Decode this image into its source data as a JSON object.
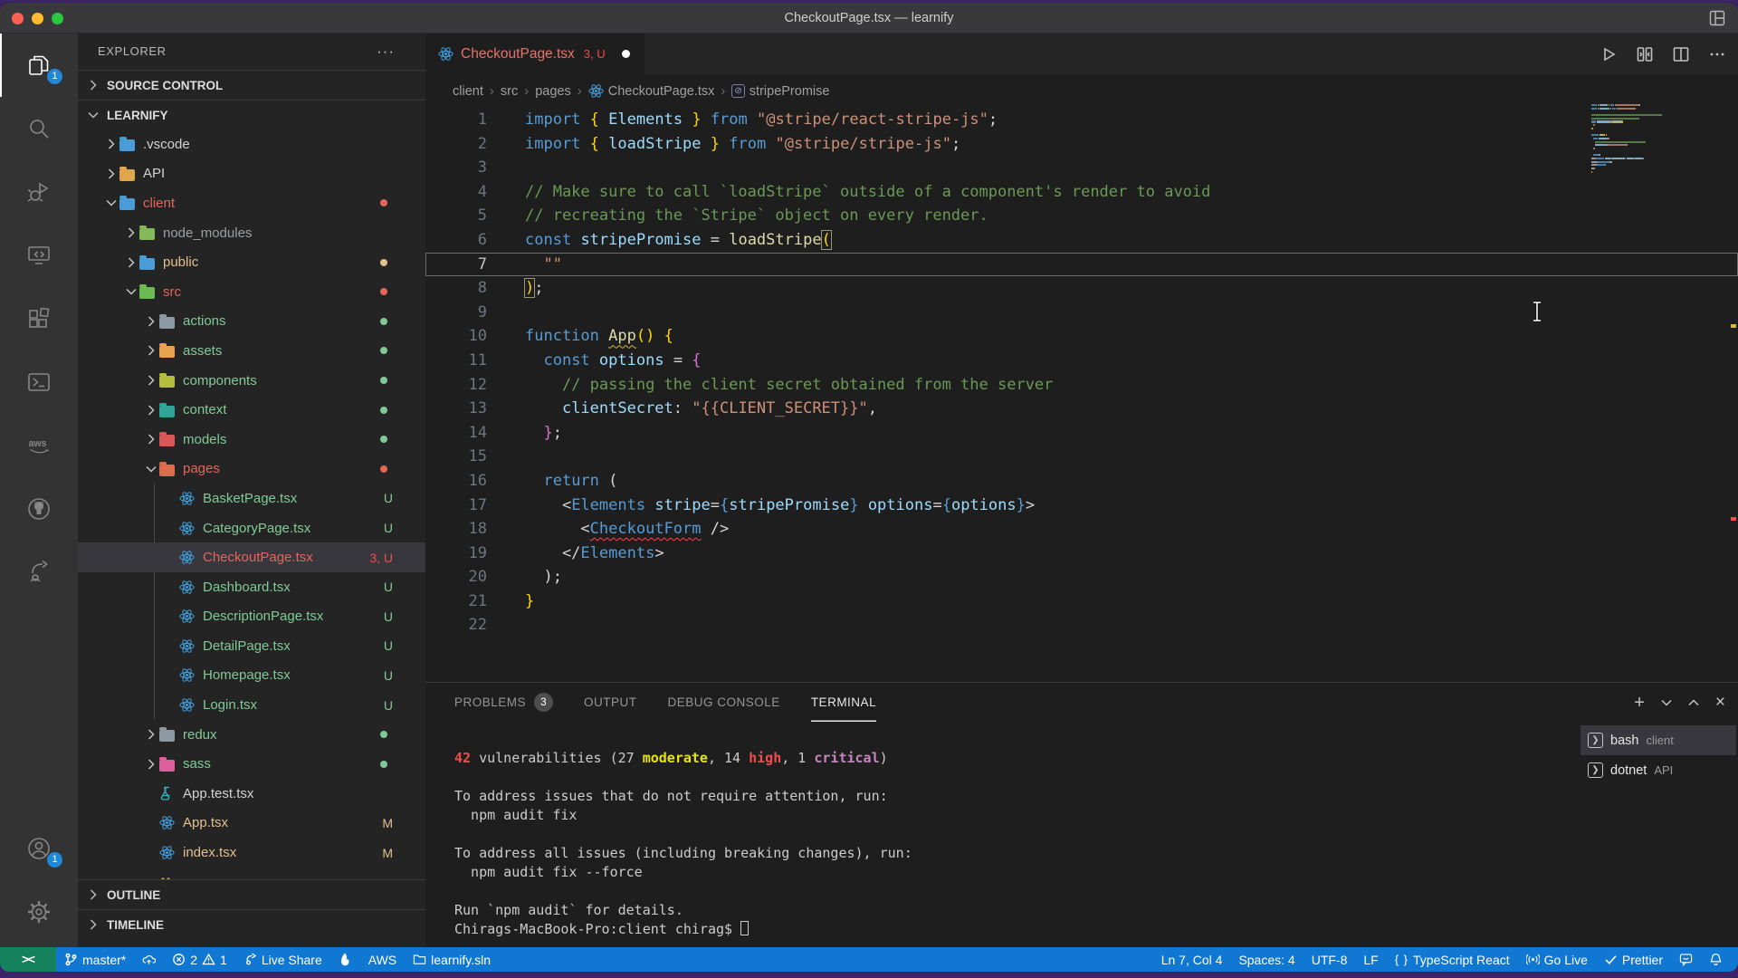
{
  "window": {
    "title": "CheckoutPage.tsx — learnify",
    "traffic_lights": [
      "close",
      "minimize",
      "zoom"
    ],
    "titlebar_right_icon": "layout-grid-icon"
  },
  "activity_bar": {
    "items": [
      {
        "name": "explorer",
        "icon": "files-icon",
        "badge": "1",
        "active": true
      },
      {
        "name": "search",
        "icon": "search-icon"
      },
      {
        "name": "run-debug",
        "icon": "debug-icon"
      },
      {
        "name": "remote-explorer",
        "icon": "remote-icon"
      },
      {
        "name": "extensions",
        "icon": "extensions-icon"
      },
      {
        "name": "powershell",
        "icon": "powershell-icon"
      },
      {
        "name": "aws",
        "icon": "aws-icon"
      },
      {
        "name": "github",
        "icon": "github-icon"
      },
      {
        "name": "live-share",
        "icon": "liveshare-icon"
      }
    ],
    "bottom_items": [
      {
        "name": "accounts",
        "icon": "account-icon",
        "badge": "1"
      },
      {
        "name": "settings",
        "icon": "gear-icon"
      }
    ]
  },
  "sidebar": {
    "header": "EXPLORER",
    "more_icon": "ellipsis-icon",
    "source_control_label": "SOURCE CONTROL",
    "workspace_label": "LEARNIFY",
    "outline_label": "OUTLINE",
    "timeline_label": "TIMELINE",
    "tree": [
      {
        "label": ".vscode",
        "kind": "folder",
        "level": 1,
        "chev": "right",
        "fcolor": "#4a9cd6",
        "tcolor": "def"
      },
      {
        "label": "API",
        "kind": "folder",
        "level": 1,
        "chev": "right",
        "fcolor": "#e0a64e",
        "tcolor": "def"
      },
      {
        "label": "client",
        "kind": "folder",
        "level": 1,
        "chev": "down",
        "fcolor": "#4a9cd6",
        "tcolor": "red",
        "dot": "#e5655b"
      },
      {
        "label": "node_modules",
        "kind": "folder",
        "level": 2,
        "chev": "right",
        "fcolor": "#85b857",
        "tcolor": "gray"
      },
      {
        "label": "public",
        "kind": "folder",
        "level": 2,
        "chev": "right",
        "fcolor": "#4a9cd6",
        "tcolor": "yellow",
        "dot": "#e2c08d"
      },
      {
        "label": "src",
        "kind": "folder",
        "level": 2,
        "chev": "down",
        "fcolor": "#6cba53",
        "tcolor": "red",
        "dot": "#e5655b"
      },
      {
        "label": "actions",
        "kind": "folder",
        "level": 3,
        "chev": "right",
        "fcolor": "#8e9aa3",
        "tcolor": "green",
        "dot": "#81c995"
      },
      {
        "label": "assets",
        "kind": "folder",
        "level": 3,
        "chev": "right",
        "fcolor": "#e8a14e",
        "tcolor": "green",
        "dot": "#81c995"
      },
      {
        "label": "components",
        "kind": "folder",
        "level": 3,
        "chev": "right",
        "fcolor": "#b5bd3e",
        "tcolor": "green",
        "dot": "#81c995"
      },
      {
        "label": "context",
        "kind": "folder",
        "level": 3,
        "chev": "right",
        "fcolor": "#2fa59a",
        "tcolor": "green",
        "dot": "#81c995"
      },
      {
        "label": "models",
        "kind": "folder",
        "level": 3,
        "chev": "right",
        "fcolor": "#d95757",
        "tcolor": "green",
        "dot": "#81c995"
      },
      {
        "label": "pages",
        "kind": "folder",
        "level": 3,
        "chev": "down",
        "fcolor": "#dd6b4d",
        "tcolor": "red",
        "dot": "#e5655b"
      },
      {
        "label": "BasketPage.tsx",
        "kind": "react",
        "level": 4,
        "tcolor": "green",
        "badge": "U",
        "bcolor": "green"
      },
      {
        "label": "CategoryPage.tsx",
        "kind": "react",
        "level": 4,
        "tcolor": "green",
        "badge": "U",
        "bcolor": "green"
      },
      {
        "label": "CheckoutPage.tsx",
        "kind": "react",
        "level": 4,
        "tcolor": "red",
        "badge": "3, U",
        "bcolor": "red",
        "selected": true
      },
      {
        "label": "Dashboard.tsx",
        "kind": "react",
        "level": 4,
        "tcolor": "green",
        "badge": "U",
        "bcolor": "green"
      },
      {
        "label": "DescriptionPage.tsx",
        "kind": "react",
        "level": 4,
        "tcolor": "green",
        "badge": "U",
        "bcolor": "green"
      },
      {
        "label": "DetailPage.tsx",
        "kind": "react",
        "level": 4,
        "tcolor": "green",
        "badge": "U",
        "bcolor": "green"
      },
      {
        "label": "Homepage.tsx",
        "kind": "react",
        "level": 4,
        "tcolor": "green",
        "badge": "U",
        "bcolor": "green"
      },
      {
        "label": "Login.tsx",
        "kind": "react",
        "level": 4,
        "tcolor": "green",
        "badge": "U",
        "bcolor": "green"
      },
      {
        "label": "redux",
        "kind": "folder",
        "level": 3,
        "chev": "right",
        "fcolor": "#8e9aa3",
        "tcolor": "green",
        "dot": "#81c995"
      },
      {
        "label": "sass",
        "kind": "folder",
        "level": 3,
        "chev": "right",
        "fcolor": "#dd5f9e",
        "tcolor": "green",
        "dot": "#81c995"
      },
      {
        "label": "App.test.tsx",
        "kind": "beaker",
        "level": 3,
        "tcolor": "def"
      },
      {
        "label": "App.tsx",
        "kind": "react",
        "level": 3,
        "tcolor": "yellow",
        "badge": "M",
        "bcolor": "yellow"
      },
      {
        "label": "index.tsx",
        "kind": "react",
        "level": 3,
        "tcolor": "yellow",
        "badge": "M",
        "bcolor": "yellow"
      },
      {
        "label": "",
        "kind": "dots",
        "level": 3,
        "tcolor": "def"
      }
    ]
  },
  "editor": {
    "tab": {
      "icon": "react-icon",
      "label": "CheckoutPage.tsx",
      "badge": "3, U",
      "dirty": true
    },
    "actions": [
      "run-icon",
      "split-diff-icon",
      "split-editor-icon",
      "ellipsis-icon"
    ],
    "breadcrumb": [
      {
        "label": "client"
      },
      {
        "label": "src"
      },
      {
        "label": "pages"
      },
      {
        "label": "CheckoutPage.tsx",
        "icon": "react-icon"
      },
      {
        "label": "stripePromise",
        "icon": "symbol-variable-icon"
      }
    ],
    "cursor_position": {
      "line": 7,
      "col": 4
    },
    "code_lines": [
      {
        "n": 1,
        "t": [
          [
            "import",
            "kw"
          ],
          [
            " ",
            "pun"
          ],
          [
            "{",
            "by"
          ],
          [
            " ",
            "pun"
          ],
          [
            "Elements",
            "var"
          ],
          [
            " ",
            "pun"
          ],
          [
            "}",
            "by"
          ],
          [
            " ",
            "pun"
          ],
          [
            "from",
            "kw"
          ],
          [
            " ",
            "pun"
          ],
          [
            "\"@stripe/react-stripe-js\"",
            "str"
          ],
          [
            ";",
            "pun"
          ]
        ]
      },
      {
        "n": 2,
        "t": [
          [
            "import",
            "kw"
          ],
          [
            " ",
            "pun"
          ],
          [
            "{",
            "by"
          ],
          [
            " ",
            "pun"
          ],
          [
            "loadStripe",
            "var"
          ],
          [
            " ",
            "pun"
          ],
          [
            "}",
            "by"
          ],
          [
            " ",
            "pun"
          ],
          [
            "from",
            "kw"
          ],
          [
            " ",
            "pun"
          ],
          [
            "\"@stripe/stripe-js\"",
            "str"
          ],
          [
            ";",
            "pun"
          ]
        ]
      },
      {
        "n": 3,
        "t": []
      },
      {
        "n": 4,
        "t": [
          [
            "// Make sure to call `loadStripe` outside of a component's render to avoid",
            "com"
          ]
        ]
      },
      {
        "n": 5,
        "t": [
          [
            "// recreating the `Stripe` object on every render.",
            "com"
          ]
        ]
      },
      {
        "n": 6,
        "t": [
          [
            "const",
            "kw"
          ],
          [
            " ",
            "pun"
          ],
          [
            "stripePromise",
            "var"
          ],
          [
            " = ",
            "pun"
          ],
          [
            "loadStripe",
            "fn"
          ],
          [
            "(",
            "bybox"
          ]
        ]
      },
      {
        "n": 7,
        "current": true,
        "t": [
          [
            "  ",
            "pun"
          ],
          [
            "\"\"",
            "str"
          ]
        ]
      },
      {
        "n": 8,
        "t": [
          [
            ")",
            "bybox"
          ],
          [
            ";",
            "pun"
          ]
        ]
      },
      {
        "n": 9,
        "t": []
      },
      {
        "n": 10,
        "t": [
          [
            "function",
            "kw"
          ],
          [
            " ",
            "pun"
          ],
          [
            "App",
            "fnwarn"
          ],
          [
            "()",
            "by"
          ],
          [
            " ",
            "pun"
          ],
          [
            "{",
            "by"
          ]
        ]
      },
      {
        "n": 11,
        "t": [
          [
            "  ",
            "pun"
          ],
          [
            "const",
            "kw"
          ],
          [
            " ",
            "pun"
          ],
          [
            "options",
            "var"
          ],
          [
            " = ",
            "pun"
          ],
          [
            "{",
            "bp"
          ]
        ]
      },
      {
        "n": 12,
        "t": [
          [
            "    ",
            "pun"
          ],
          [
            "// passing the client secret obtained from the server",
            "com"
          ]
        ]
      },
      {
        "n": 13,
        "t": [
          [
            "    ",
            "pun"
          ],
          [
            "clientSecret",
            "var"
          ],
          [
            ": ",
            "pun"
          ],
          [
            "\"{{CLIENT_SECRET}}\"",
            "str"
          ],
          [
            ",",
            "pun"
          ]
        ]
      },
      {
        "n": 14,
        "t": [
          [
            "  ",
            "pun"
          ],
          [
            "}",
            "bp"
          ],
          [
            ";",
            "pun"
          ]
        ]
      },
      {
        "n": 15,
        "t": []
      },
      {
        "n": 16,
        "t": [
          [
            "  ",
            "pun"
          ],
          [
            "return",
            "kw"
          ],
          [
            " (",
            "pun"
          ]
        ]
      },
      {
        "n": 17,
        "t": [
          [
            "    <",
            "pun"
          ],
          [
            "Elements",
            "kw"
          ],
          [
            " ",
            "pun"
          ],
          [
            "stripe",
            "var"
          ],
          [
            "=",
            "pun"
          ],
          [
            "{",
            "kw"
          ],
          [
            "stripePromise",
            "var"
          ],
          [
            "}",
            "kw"
          ],
          [
            " ",
            "pun"
          ],
          [
            "options",
            "var"
          ],
          [
            "=",
            "pun"
          ],
          [
            "{",
            "kw"
          ],
          [
            "options",
            "var"
          ],
          [
            "}",
            "kw"
          ],
          [
            ">",
            "pun"
          ]
        ]
      },
      {
        "n": 18,
        "t": [
          [
            "      <",
            "pun"
          ],
          [
            "CheckoutForm",
            "tagerr"
          ],
          [
            " />",
            "pun"
          ]
        ]
      },
      {
        "n": 19,
        "t": [
          [
            "    </",
            "pun"
          ],
          [
            "Elements",
            "kw"
          ],
          [
            ">",
            "pun"
          ]
        ]
      },
      {
        "n": 20,
        "t": [
          [
            "  )",
            "pun"
          ],
          [
            ";",
            "pun"
          ]
        ]
      },
      {
        "n": 21,
        "t": [
          [
            "}",
            "by"
          ]
        ]
      },
      {
        "n": 22,
        "t": []
      }
    ]
  },
  "panel": {
    "tabs": [
      {
        "label": "PROBLEMS",
        "badge": "3"
      },
      {
        "label": "OUTPUT"
      },
      {
        "label": "DEBUG CONSOLE"
      },
      {
        "label": "TERMINAL",
        "active": true
      }
    ],
    "actions": [
      "plus-icon",
      "chevron-down-icon",
      "chevron-up-icon",
      "close-icon"
    ],
    "terminal_lines": [
      [
        [
          "42",
          "red"
        ],
        [
          " vulnerabilities (27 ",
          "def"
        ],
        [
          "moderate",
          "yel"
        ],
        [
          ", 14 ",
          "def"
        ],
        [
          "high",
          "red"
        ],
        [
          ", 1 ",
          "def"
        ],
        [
          "critical",
          "mag"
        ],
        [
          ")",
          "def"
        ]
      ],
      [],
      [
        [
          "To address issues that do not require attention, run:",
          "def"
        ]
      ],
      [
        [
          "  npm audit fix",
          "def"
        ]
      ],
      [],
      [
        [
          "To address all issues (including breaking changes), run:",
          "def"
        ]
      ],
      [
        [
          "  npm audit fix --force",
          "def"
        ]
      ],
      [],
      [
        [
          "Run `npm audit` for details.",
          "def"
        ]
      ],
      [
        [
          "Chirags-MacBook-Pro:client chirag$ ",
          "def"
        ],
        [
          "CURSOR",
          "cursor"
        ]
      ]
    ],
    "terminals": [
      {
        "icon": "terminal-icon",
        "name": "bash",
        "secondary": "client",
        "selected": true
      },
      {
        "icon": "terminal-icon",
        "name": "dotnet",
        "secondary": "API"
      }
    ]
  },
  "status_bar": {
    "remote_label": "><",
    "left": [
      {
        "name": "git-branch",
        "icon": "branch-icon",
        "label": "master*"
      },
      {
        "name": "sync",
        "icon": "cloud-upload-icon",
        "label": ""
      },
      {
        "name": "problems",
        "icon": "error-icon",
        "label": "2",
        "icon2": "warning-icon",
        "label2": "1"
      },
      {
        "name": "live-share",
        "icon": "share-icon",
        "label": "Live Share"
      },
      {
        "name": "flame",
        "icon": "flame-icon",
        "label": ""
      },
      {
        "name": "aws",
        "icon": "",
        "label": "AWS"
      },
      {
        "name": "solution",
        "icon": "folder-outline-icon",
        "label": "learnify.sln"
      }
    ],
    "right": [
      {
        "name": "cursor-position",
        "icon": "",
        "label": "Ln 7, Col 4"
      },
      {
        "name": "indentation",
        "icon": "",
        "label": "Spaces: 4"
      },
      {
        "name": "encoding",
        "icon": "",
        "label": "UTF-8"
      },
      {
        "name": "eol",
        "icon": "",
        "label": "LF"
      },
      {
        "name": "language-mode",
        "icon": "braces-icon",
        "label": "TypeScript React"
      },
      {
        "name": "go-live",
        "icon": "broadcast-icon",
        "label": "Go Live"
      },
      {
        "name": "prettier",
        "icon": "check-icon",
        "label": "Prettier"
      },
      {
        "name": "feedback",
        "icon": "feedback-icon",
        "label": ""
      },
      {
        "name": "notifications",
        "icon": "bell-icon",
        "label": ""
      }
    ],
    "colors": {
      "bar": "#1077d2",
      "remote": "#16825d"
    }
  }
}
